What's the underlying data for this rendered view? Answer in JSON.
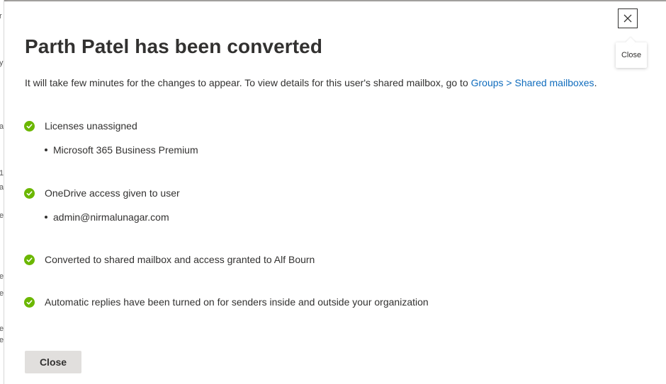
{
  "background_fragments": [
    "r",
    "y",
    "a",
    "a",
    "1",
    "e",
    "e",
    "e",
    "e",
    "e"
  ],
  "dialog": {
    "title": "Parth Patel has been converted",
    "subtitle_text": "It will take few minutes for the changes to appear. To view details for this user's shared mailbox, go to ",
    "subtitle_link": "Groups > Shared mailboxes",
    "subtitle_end": ".",
    "close_x_tooltip": "Close",
    "close_button_label": "Close"
  },
  "status_items": [
    {
      "label": "Licenses unassigned",
      "details": [
        "Microsoft 365 Business Premium"
      ],
      "status": "success"
    },
    {
      "label": "OneDrive access given to user",
      "details": [
        "admin@nirmalunagar.com"
      ],
      "status": "success"
    },
    {
      "label": "Converted to shared mailbox and access granted to Alf Bourn",
      "details": [],
      "status": "success"
    },
    {
      "label": "Automatic replies have been turned on for senders inside and outside your organization",
      "details": [],
      "status": "success"
    }
  ],
  "colors": {
    "success": "#6bb700",
    "link": "#0f6cbd",
    "text": "#323130",
    "button_bg": "#e1dfdd"
  },
  "icons": {
    "success": "checkmark-circle-icon",
    "close": "close-icon"
  }
}
